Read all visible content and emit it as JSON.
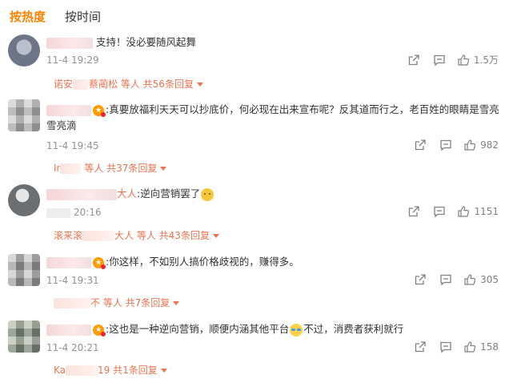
{
  "tabs": [
    {
      "label": "按热度",
      "active": true
    },
    {
      "label": "按时间",
      "active": false
    }
  ],
  "colors": {
    "accent": "#ff8200",
    "link": "#eb7350",
    "meta": "#939393"
  },
  "comments": [
    {
      "text": "支持！没必要随风起舞",
      "time": "11-4 19:29",
      "likes": "1.5万",
      "replies_prefix": "诺安",
      "replies_name": "蔡蔺松",
      "replies_summary": "等人 共56条回复"
    },
    {
      "text": ":真要放福利天天可以抄底价，何必现在出来宣布呢？反其道而行之，老百姓的眼睛是雪亮雪亮滴",
      "time": "11-4 19:45",
      "likes": "982",
      "replies_prefix": "Ir",
      "replies_name": "",
      "replies_summary": "等人 共37条回复"
    },
    {
      "name_tail": "大人",
      "text": ":逆向营销罢了",
      "time": "20:16",
      "likes": "1151",
      "replies_prefix": "滚来滚",
      "replies_name": "大人",
      "replies_summary": "等人 共43条回复"
    },
    {
      "text": ":你这样，不如别人搞价格歧视的，赚得多。",
      "time": "11-4 19:31",
      "likes": "305",
      "replies_prefix": "",
      "replies_name": "不",
      "replies_summary": "等人 共7条回复"
    },
    {
      "text_a": ":这也是一种逆向营销，顺便内涵其他平台",
      "text_b": "不过，消费者获利就行",
      "time": "11-4 20:21",
      "likes": "158",
      "replies_prefix": "Ka",
      "replies_name": "19",
      "replies_summary": "共1条回复"
    }
  ]
}
